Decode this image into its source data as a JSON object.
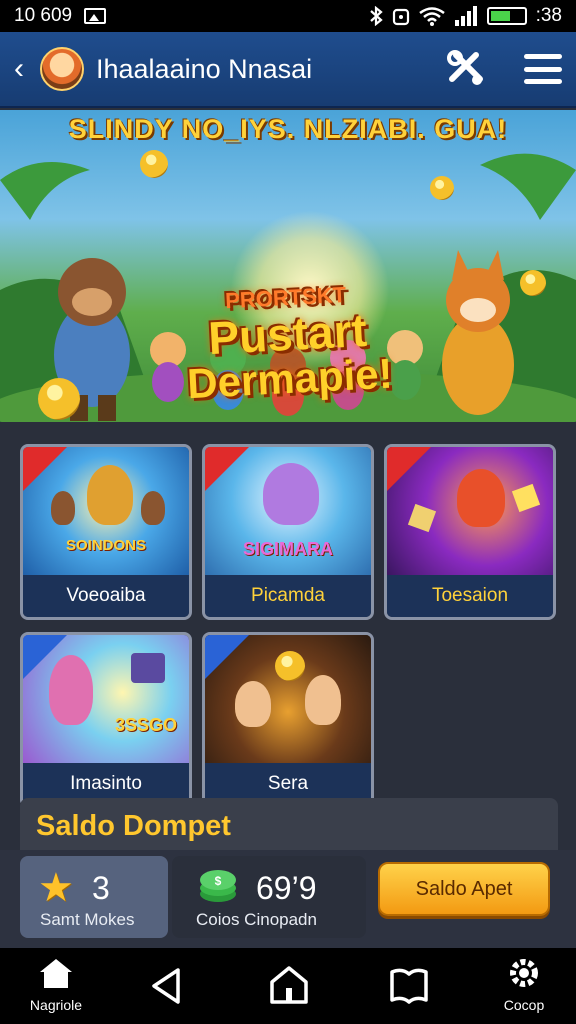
{
  "status_bar": {
    "time_left": "10 609",
    "time_right": ":38"
  },
  "app_bar": {
    "title": "Ihaalaaino Nnasai"
  },
  "banner": {
    "headline": "SLINDY NO_IYS. NLZIABI. GUA!",
    "logo_small": "PRORTSKT",
    "logo_line1": "Pustart",
    "logo_line2": "Dermapie!"
  },
  "games": [
    {
      "label": "Voeoaiba",
      "art_text": "SOINDONS",
      "tag": "red"
    },
    {
      "label": "Picamda",
      "art_text": "SIGIMARA",
      "tag": "red"
    },
    {
      "label": "Toesaion",
      "art_text": "",
      "tag": "red"
    },
    {
      "label": "Imasinto",
      "art_text": "3SSGO",
      "tag": "blue"
    },
    {
      "label": "Sera",
      "art_text": "",
      "tag": "blue"
    }
  ],
  "wallet": {
    "title": "Saldo Dompet",
    "stars_value": "3",
    "stars_label": "Samt Mokes",
    "coins_value": "69’9",
    "coins_label": "Coios Cinopadn",
    "button_label": "Saldo Apet"
  },
  "nav": {
    "home_label": "Nagriole",
    "settings_label": "Cocop"
  },
  "colors": {
    "accent": "#ffc72e",
    "appbar": "#1f4d8e",
    "background": "#2a2f3b"
  }
}
